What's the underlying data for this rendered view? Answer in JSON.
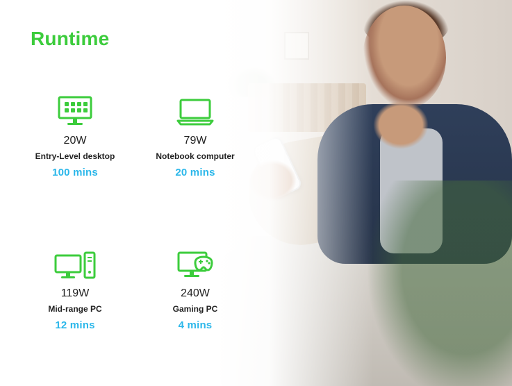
{
  "title": "Runtime",
  "colors": {
    "accent_green": "#3ccc3c",
    "runtime_blue": "#2bb7ea",
    "text_dark": "#222222"
  },
  "devices": [
    {
      "icon": "desktop-monitor-grid-icon",
      "watts": "20W",
      "name": "Entry-Level desktop",
      "runtime": "100 mins"
    },
    {
      "icon": "laptop-icon",
      "watts": "79W",
      "name": "Notebook computer",
      "runtime": "20 mins"
    },
    {
      "icon": "monitor-tower-icon",
      "watts": "119W",
      "name": "Mid-range PC",
      "runtime": "12 mins"
    },
    {
      "icon": "gaming-monitor-controller-icon",
      "watts": "240W",
      "name": "Gaming PC",
      "runtime": "4 mins"
    }
  ]
}
